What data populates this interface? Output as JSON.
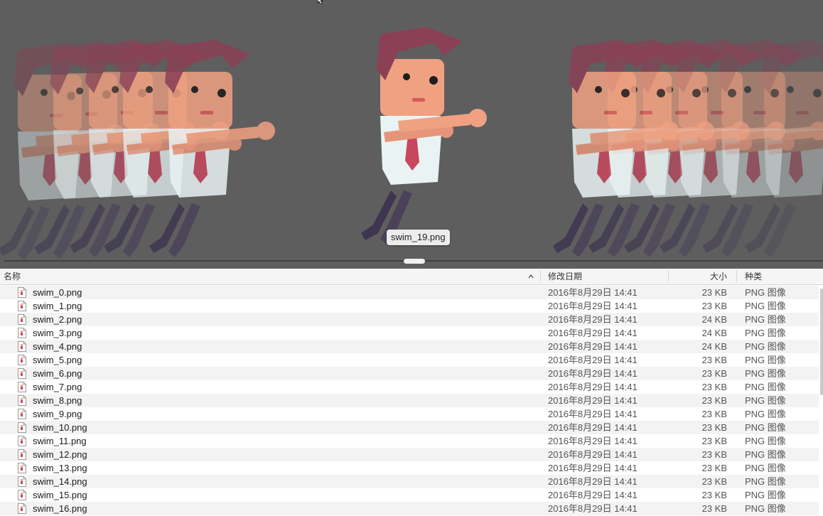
{
  "preview": {
    "caption": "swim_19.png"
  },
  "list": {
    "columns": {
      "name": "名称",
      "date": "修改日期",
      "size": "大小",
      "kind": "种类"
    },
    "sort": "name-ascending",
    "files": [
      {
        "name": "swim_0.png",
        "date": "2016年8月29日 14:41",
        "size": "23 KB",
        "kind": "PNG 图像"
      },
      {
        "name": "swim_1.png",
        "date": "2016年8月29日 14:41",
        "size": "23 KB",
        "kind": "PNG 图像"
      },
      {
        "name": "swim_2.png",
        "date": "2016年8月29日 14:41",
        "size": "24 KB",
        "kind": "PNG 图像"
      },
      {
        "name": "swim_3.png",
        "date": "2016年8月29日 14:41",
        "size": "24 KB",
        "kind": "PNG 图像"
      },
      {
        "name": "swim_4.png",
        "date": "2016年8月29日 14:41",
        "size": "24 KB",
        "kind": "PNG 图像"
      },
      {
        "name": "swim_5.png",
        "date": "2016年8月29日 14:41",
        "size": "23 KB",
        "kind": "PNG 图像"
      },
      {
        "name": "swim_6.png",
        "date": "2016年8月29日 14:41",
        "size": "23 KB",
        "kind": "PNG 图像"
      },
      {
        "name": "swim_7.png",
        "date": "2016年8月29日 14:41",
        "size": "23 KB",
        "kind": "PNG 图像"
      },
      {
        "name": "swim_8.png",
        "date": "2016年8月29日 14:41",
        "size": "23 KB",
        "kind": "PNG 图像"
      },
      {
        "name": "swim_9.png",
        "date": "2016年8月29日 14:41",
        "size": "23 KB",
        "kind": "PNG 图像"
      },
      {
        "name": "swim_10.png",
        "date": "2016年8月29日 14:41",
        "size": "23 KB",
        "kind": "PNG 图像"
      },
      {
        "name": "swim_11.png",
        "date": "2016年8月29日 14:41",
        "size": "23 KB",
        "kind": "PNG 图像"
      },
      {
        "name": "swim_12.png",
        "date": "2016年8月29日 14:41",
        "size": "23 KB",
        "kind": "PNG 图像"
      },
      {
        "name": "swim_13.png",
        "date": "2016年8月29日 14:41",
        "size": "23 KB",
        "kind": "PNG 图像"
      },
      {
        "name": "swim_14.png",
        "date": "2016年8月29日 14:41",
        "size": "23 KB",
        "kind": "PNG 图像"
      },
      {
        "name": "swim_15.png",
        "date": "2016年8月29日 14:41",
        "size": "23 KB",
        "kind": "PNG 图像"
      },
      {
        "name": "swim_16.png",
        "date": "2016年8月29日 14:41",
        "size": "23 KB",
        "kind": "PNG 图像"
      }
    ]
  },
  "icons": {
    "sort_indicator": "chevron-up-icon",
    "file": "png-file-icon",
    "pointer": "mouse-cursor-icon"
  },
  "colors": {
    "preview_background": "#5e5e5e",
    "hair": "#8b4056",
    "skin": "#f0a182",
    "shirt": "#e9f3f4",
    "tie": "#c8475e",
    "pants": "#4b4259"
  }
}
